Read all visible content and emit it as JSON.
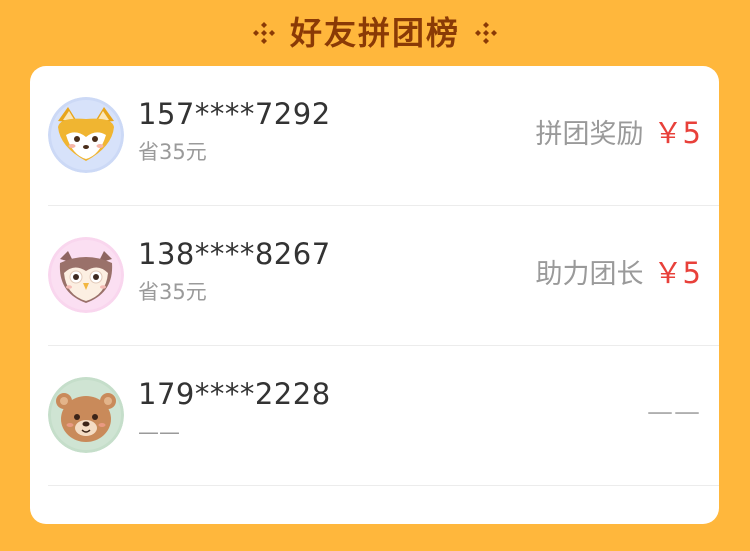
{
  "header": {
    "title": "好友拼团榜",
    "decoration_icon": "sparkle-diamond-icon"
  },
  "colors": {
    "background": "#FFB73C",
    "title": "#8A3A06",
    "amount": "#E8403A",
    "muted": "#9A9A9A"
  },
  "friends": [
    {
      "phone": "157****7292",
      "saved": "省35元",
      "reward_label": "拼团奖励",
      "reward_amount": "￥5",
      "avatar_icon": "fox-avatar-icon"
    },
    {
      "phone": "138****8267",
      "saved": "省35元",
      "reward_label": "助力团长",
      "reward_amount": "￥5",
      "avatar_icon": "owl-avatar-icon"
    },
    {
      "phone": "179****2228",
      "saved": "——",
      "reward_empty": "——",
      "avatar_icon": "bear-avatar-icon"
    }
  ]
}
